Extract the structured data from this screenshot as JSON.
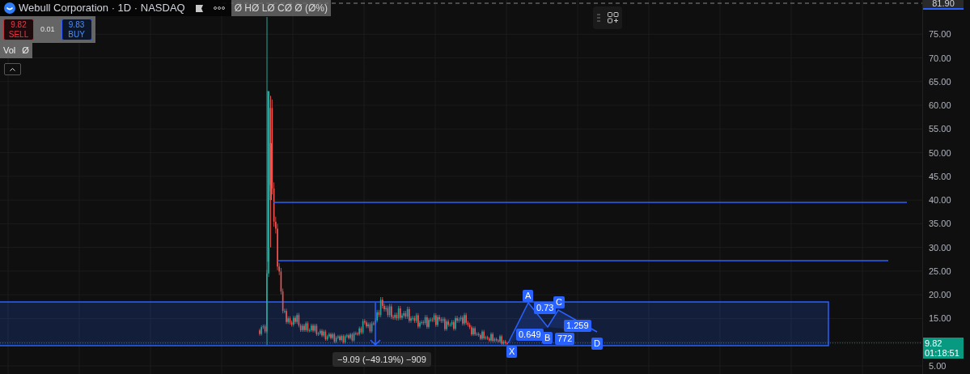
{
  "legend": {
    "title": "Webull Corporation · 1D · NASDAQ",
    "ohlc": "Ø HØ LØ CØ Ø (Ø%)",
    "sell": {
      "price": "9.82",
      "label": "SELL"
    },
    "spread": "0.01",
    "buy": {
      "price": "9.83",
      "label": "BUY"
    },
    "volume": {
      "label": "Vol",
      "value": "Ø"
    }
  },
  "price_axis": {
    "labels": [
      "75.00",
      "70.00",
      "65.00",
      "60.00",
      "55.00",
      "50.00",
      "45.00",
      "40.00",
      "35.00",
      "30.00",
      "25.00",
      "20.00",
      "15.00",
      "5.00"
    ],
    "high_label": "81.90",
    "current_price": "9.82",
    "countdown": "01:18:51"
  },
  "measure": {
    "label": "−9.09 (−49.19%) −909"
  },
  "pattern": {
    "points": [
      {
        "label": "X"
      },
      {
        "label": "A"
      },
      {
        "label": "B"
      },
      {
        "label": "C"
      },
      {
        "label": "D"
      }
    ],
    "ratios": [
      "0.649",
      "0.73",
      "772",
      "1.259"
    ]
  }
}
